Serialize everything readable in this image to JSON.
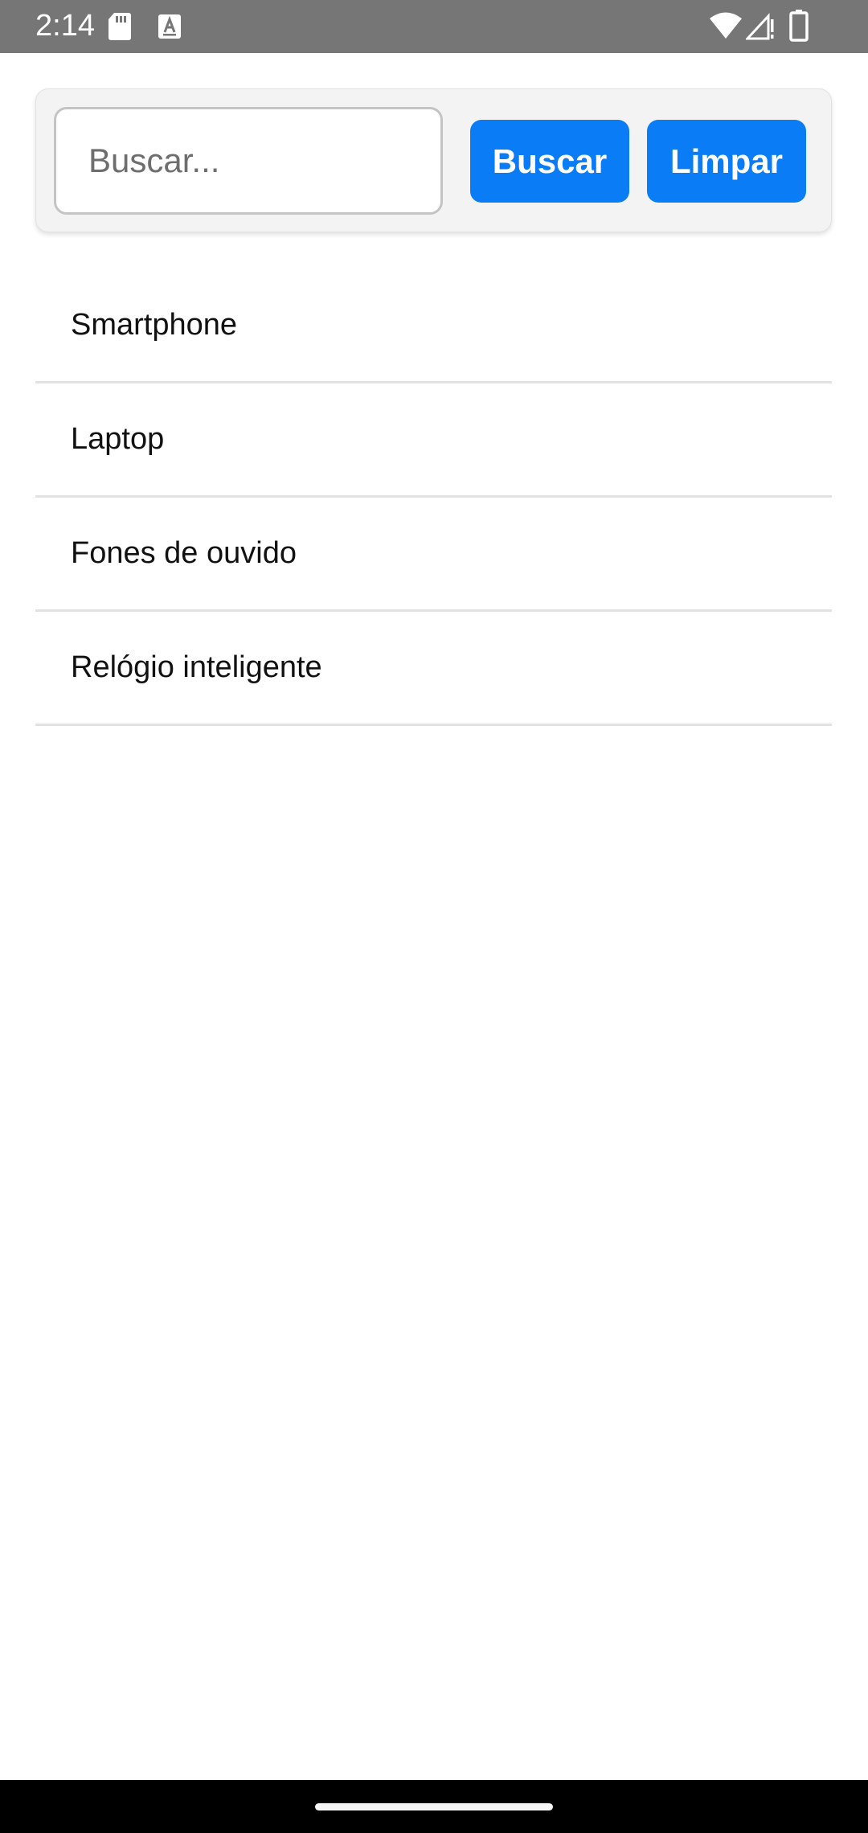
{
  "status_bar": {
    "time": "2:14",
    "icons": [
      "sd-card-icon",
      "text-a-icon",
      "wifi-icon",
      "cellular-signal-icon",
      "battery-icon"
    ]
  },
  "search": {
    "placeholder": "Buscar...",
    "value": "",
    "search_button_label": "Buscar",
    "clear_button_label": "Limpar"
  },
  "products": [
    {
      "label": "Smartphone"
    },
    {
      "label": "Laptop"
    },
    {
      "label": "Fones de ouvido"
    },
    {
      "label": "Relógio inteligente"
    }
  ],
  "colors": {
    "accent": "#0a7cf5",
    "status_bar": "#767676",
    "panel_background": "#f3f3f3",
    "divider": "#e2e2e2"
  }
}
